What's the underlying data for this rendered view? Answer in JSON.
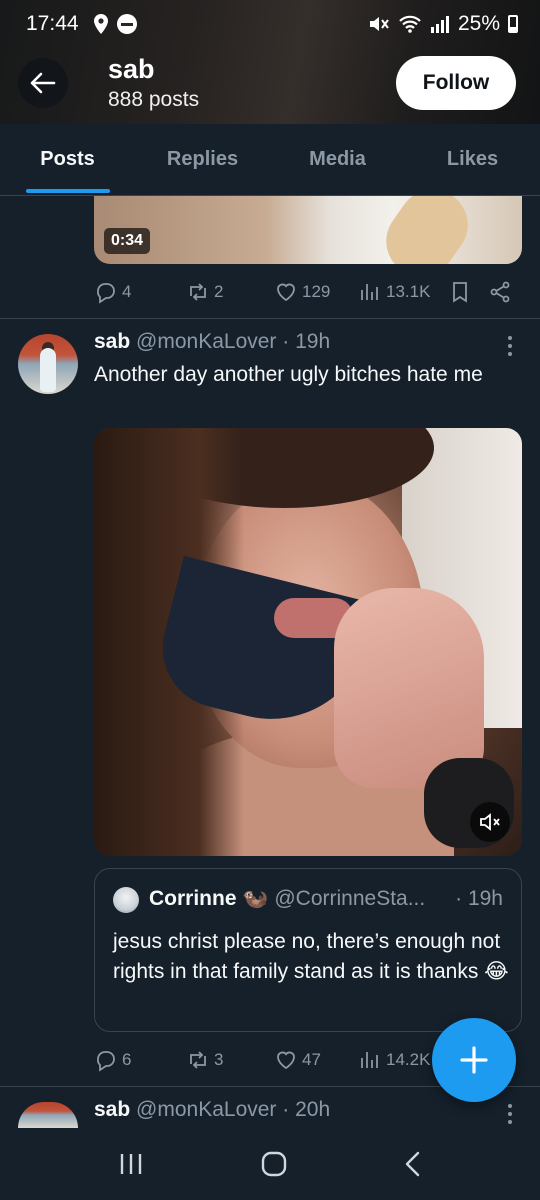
{
  "status_bar": {
    "time": "17:44",
    "battery": "25%"
  },
  "header": {
    "name": "sab",
    "post_count": "888 posts",
    "follow_label": "Follow"
  },
  "tabs": [
    {
      "label": "Posts",
      "active": true
    },
    {
      "label": "Replies",
      "active": false
    },
    {
      "label": "Media",
      "active": false
    },
    {
      "label": "Likes",
      "active": false
    }
  ],
  "previous_tweet": {
    "video_duration": "0:34",
    "replies": "4",
    "reposts": "2",
    "likes": "129",
    "views": "13.1K"
  },
  "tweet": {
    "name": "sab",
    "handle": "@monKaLover",
    "time": "· 19h",
    "text": "Another day another ugly bitches hate me",
    "replies": "6",
    "reposts": "3",
    "likes": "47",
    "views": "14.2K",
    "quote": {
      "name": "Corrinne 🦦",
      "handle": "@CorrinneSta...",
      "time": "· 19h",
      "text": "jesus christ please no, there’s enough not rights in that family stand as it is thanks 😂"
    }
  },
  "next_tweet": {
    "name": "sab",
    "handle": "@monKaLover",
    "time": "· 20h"
  },
  "colors": {
    "accent": "#1d9bf0",
    "background": "#15202b",
    "muted": "#8b98a5"
  }
}
